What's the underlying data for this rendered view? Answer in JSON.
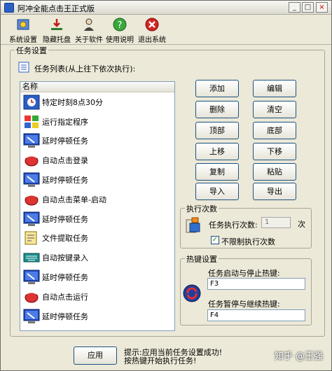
{
  "window": {
    "title": "阿冲全能点击王正式版",
    "min": "_",
    "max": "□",
    "close": "×"
  },
  "toolbar": {
    "items": [
      {
        "label": "系统设置",
        "icon": "settings-icon"
      },
      {
        "label": "隐藏托盘",
        "icon": "hide-tray-icon"
      },
      {
        "label": "关于软件",
        "icon": "about-icon"
      },
      {
        "label": "使用说明",
        "icon": "help-icon"
      },
      {
        "label": "退出系统",
        "icon": "exit-icon"
      }
    ]
  },
  "task_settings": {
    "legend": "任务设置",
    "list_title": "任务列表(从上往下依次执行):",
    "column_header": "名称",
    "items": [
      {
        "label": "特定时刻8点30分",
        "icon": "clock-task-icon"
      },
      {
        "label": "运行指定程序",
        "icon": "program-task-icon"
      },
      {
        "label": "延时停顿任务",
        "icon": "delay-task-icon"
      },
      {
        "label": "自动点击登录",
        "icon": "mouse-click-task-icon"
      },
      {
        "label": "延时停顿任务",
        "icon": "delay-task-icon"
      },
      {
        "label": "自动点击菜单-启动",
        "icon": "mouse-click-task-icon"
      },
      {
        "label": "延时停顿任务",
        "icon": "delay-task-icon"
      },
      {
        "label": "文件提取任务",
        "icon": "file-extract-task-icon"
      },
      {
        "label": "自动按键录入",
        "icon": "keyboard-task-icon"
      },
      {
        "label": "延时停顿任务",
        "icon": "delay-task-icon"
      },
      {
        "label": "自动点击运行",
        "icon": "mouse-click-task-icon"
      },
      {
        "label": "延时停顿任务",
        "icon": "delay-task-icon"
      }
    ],
    "buttons": {
      "add": "添加",
      "edit": "编辑",
      "delete": "删除",
      "clear": "清空",
      "top": "顶部",
      "bottom": "底部",
      "up": "上移",
      "down": "下移",
      "copy": "复制",
      "paste": "粘贴",
      "import": "导入",
      "export": "导出"
    }
  },
  "exec_count": {
    "legend": "执行次数",
    "label": "任务执行次数:",
    "value": "1",
    "unit": "次",
    "unlimited_label": "不限制执行次数",
    "unlimited_checked": "✓"
  },
  "hotkeys": {
    "legend": "热键设置",
    "start_stop_label": "任务启动与停止热键:",
    "start_stop_value": "F3",
    "pause_resume_label": "任务暂停与继续热键:",
    "pause_resume_value": "F4"
  },
  "footer": {
    "apply": "应用",
    "tip_line1": "提示:应用当前任务设置成功!",
    "tip_line2": "按热键开始执行任务!"
  },
  "watermark": "知乎 @王强"
}
